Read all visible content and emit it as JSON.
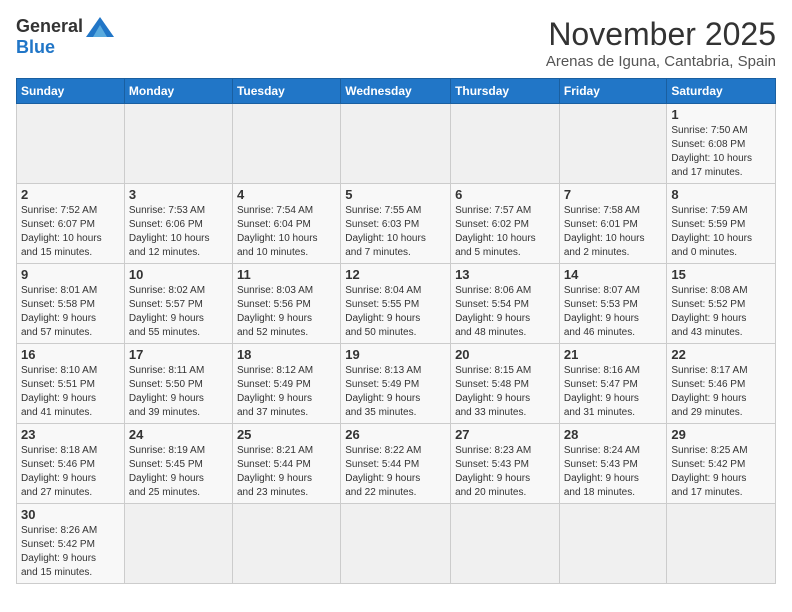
{
  "header": {
    "logo_general": "General",
    "logo_blue": "Blue",
    "month_title": "November 2025",
    "location": "Arenas de Iguna, Cantabria, Spain"
  },
  "weekdays": [
    "Sunday",
    "Monday",
    "Tuesday",
    "Wednesday",
    "Thursday",
    "Friday",
    "Saturday"
  ],
  "weeks": [
    [
      {
        "day": "",
        "info": ""
      },
      {
        "day": "",
        "info": ""
      },
      {
        "day": "",
        "info": ""
      },
      {
        "day": "",
        "info": ""
      },
      {
        "day": "",
        "info": ""
      },
      {
        "day": "",
        "info": ""
      },
      {
        "day": "1",
        "info": "Sunrise: 7:50 AM\nSunset: 6:08 PM\nDaylight: 10 hours\nand 17 minutes."
      }
    ],
    [
      {
        "day": "2",
        "info": "Sunrise: 7:52 AM\nSunset: 6:07 PM\nDaylight: 10 hours\nand 15 minutes."
      },
      {
        "day": "3",
        "info": "Sunrise: 7:53 AM\nSunset: 6:06 PM\nDaylight: 10 hours\nand 12 minutes."
      },
      {
        "day": "4",
        "info": "Sunrise: 7:54 AM\nSunset: 6:04 PM\nDaylight: 10 hours\nand 10 minutes."
      },
      {
        "day": "5",
        "info": "Sunrise: 7:55 AM\nSunset: 6:03 PM\nDaylight: 10 hours\nand 7 minutes."
      },
      {
        "day": "6",
        "info": "Sunrise: 7:57 AM\nSunset: 6:02 PM\nDaylight: 10 hours\nand 5 minutes."
      },
      {
        "day": "7",
        "info": "Sunrise: 7:58 AM\nSunset: 6:01 PM\nDaylight: 10 hours\nand 2 minutes."
      },
      {
        "day": "8",
        "info": "Sunrise: 7:59 AM\nSunset: 5:59 PM\nDaylight: 10 hours\nand 0 minutes."
      }
    ],
    [
      {
        "day": "9",
        "info": "Sunrise: 8:01 AM\nSunset: 5:58 PM\nDaylight: 9 hours\nand 57 minutes."
      },
      {
        "day": "10",
        "info": "Sunrise: 8:02 AM\nSunset: 5:57 PM\nDaylight: 9 hours\nand 55 minutes."
      },
      {
        "day": "11",
        "info": "Sunrise: 8:03 AM\nSunset: 5:56 PM\nDaylight: 9 hours\nand 52 minutes."
      },
      {
        "day": "12",
        "info": "Sunrise: 8:04 AM\nSunset: 5:55 PM\nDaylight: 9 hours\nand 50 minutes."
      },
      {
        "day": "13",
        "info": "Sunrise: 8:06 AM\nSunset: 5:54 PM\nDaylight: 9 hours\nand 48 minutes."
      },
      {
        "day": "14",
        "info": "Sunrise: 8:07 AM\nSunset: 5:53 PM\nDaylight: 9 hours\nand 46 minutes."
      },
      {
        "day": "15",
        "info": "Sunrise: 8:08 AM\nSunset: 5:52 PM\nDaylight: 9 hours\nand 43 minutes."
      }
    ],
    [
      {
        "day": "16",
        "info": "Sunrise: 8:10 AM\nSunset: 5:51 PM\nDaylight: 9 hours\nand 41 minutes."
      },
      {
        "day": "17",
        "info": "Sunrise: 8:11 AM\nSunset: 5:50 PM\nDaylight: 9 hours\nand 39 minutes."
      },
      {
        "day": "18",
        "info": "Sunrise: 8:12 AM\nSunset: 5:49 PM\nDaylight: 9 hours\nand 37 minutes."
      },
      {
        "day": "19",
        "info": "Sunrise: 8:13 AM\nSunset: 5:49 PM\nDaylight: 9 hours\nand 35 minutes."
      },
      {
        "day": "20",
        "info": "Sunrise: 8:15 AM\nSunset: 5:48 PM\nDaylight: 9 hours\nand 33 minutes."
      },
      {
        "day": "21",
        "info": "Sunrise: 8:16 AM\nSunset: 5:47 PM\nDaylight: 9 hours\nand 31 minutes."
      },
      {
        "day": "22",
        "info": "Sunrise: 8:17 AM\nSunset: 5:46 PM\nDaylight: 9 hours\nand 29 minutes."
      }
    ],
    [
      {
        "day": "23",
        "info": "Sunrise: 8:18 AM\nSunset: 5:46 PM\nDaylight: 9 hours\nand 27 minutes."
      },
      {
        "day": "24",
        "info": "Sunrise: 8:19 AM\nSunset: 5:45 PM\nDaylight: 9 hours\nand 25 minutes."
      },
      {
        "day": "25",
        "info": "Sunrise: 8:21 AM\nSunset: 5:44 PM\nDaylight: 9 hours\nand 23 minutes."
      },
      {
        "day": "26",
        "info": "Sunrise: 8:22 AM\nSunset: 5:44 PM\nDaylight: 9 hours\nand 22 minutes."
      },
      {
        "day": "27",
        "info": "Sunrise: 8:23 AM\nSunset: 5:43 PM\nDaylight: 9 hours\nand 20 minutes."
      },
      {
        "day": "28",
        "info": "Sunrise: 8:24 AM\nSunset: 5:43 PM\nDaylight: 9 hours\nand 18 minutes."
      },
      {
        "day": "29",
        "info": "Sunrise: 8:25 AM\nSunset: 5:42 PM\nDaylight: 9 hours\nand 17 minutes."
      }
    ],
    [
      {
        "day": "30",
        "info": "Sunrise: 8:26 AM\nSunset: 5:42 PM\nDaylight: 9 hours\nand 15 minutes."
      },
      {
        "day": "",
        "info": ""
      },
      {
        "day": "",
        "info": ""
      },
      {
        "day": "",
        "info": ""
      },
      {
        "day": "",
        "info": ""
      },
      {
        "day": "",
        "info": ""
      },
      {
        "day": "",
        "info": ""
      }
    ]
  ]
}
